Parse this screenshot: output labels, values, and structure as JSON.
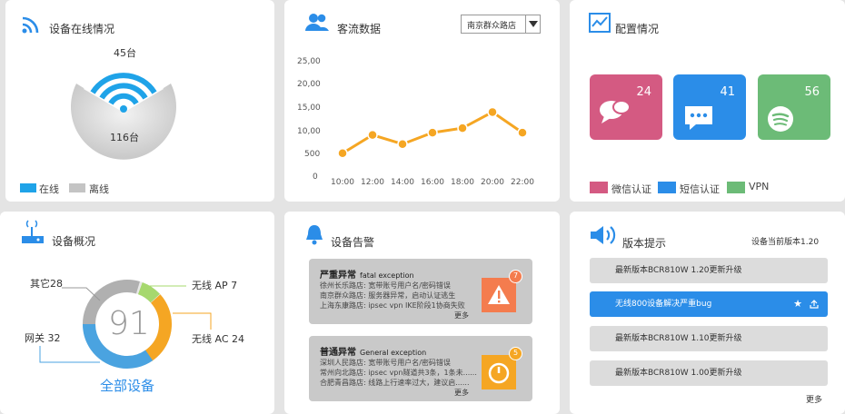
{
  "online": {
    "title": "设备在线情况",
    "online_count": "45台",
    "offline_count": "116台",
    "legend": [
      {
        "label": "在线",
        "color": "#1fa3e8"
      },
      {
        "label": "离线",
        "color": "#c4c4c4"
      }
    ]
  },
  "traffic": {
    "title": "客流数据",
    "store_select": "南京群众路店",
    "y_ticks": [
      "25,00",
      "20,00",
      "15,00",
      "10,00",
      "500",
      "0"
    ],
    "color": "#f5a623"
  },
  "config": {
    "title": "配置情况",
    "tiles": [
      {
        "count": "24",
        "label": "微信认证",
        "color": "#d45a82",
        "icon": "chat-bubbles-icon"
      },
      {
        "count": "41",
        "label": "短信认证",
        "color": "#2b8de8",
        "icon": "sms-icon"
      },
      {
        "count": "56",
        "label": "VPN",
        "color": "#6cbb77",
        "icon": "spotify-icon"
      }
    ]
  },
  "overview": {
    "title": "设备概况",
    "total": "91",
    "total_label": "全部设备",
    "labels": {
      "other": "其它28",
      "wireless_ap": "无线 AP  7",
      "wireless_ac": "无线 AC 24",
      "gateway": "网关 32"
    }
  },
  "alerts": {
    "title": "设备告警",
    "severe": {
      "title": "严重异常",
      "subtitle": "fatal exception",
      "lines": [
        "徐州长乐路店:   宽带账号用户名/密码错误",
        "南京群众路店:   服务器异常，启动认证逃生",
        "上海东康路店:   ipsec vpn IKE阶段1协商失败"
      ],
      "badge": "7",
      "more": "更多"
    },
    "general": {
      "title": "普通异常",
      "subtitle": "General exception",
      "lines": [
        "深圳人民路店:   宽带账号用户名/密码错误",
        "常州向北路店:   ipsec vpn隧道共3条，1条未......",
        "合肥青昌路店:   线路上行速率过大，建议启......"
      ],
      "badge": "5",
      "more": "更多"
    }
  },
  "versions": {
    "title": "版本提示",
    "current": "设备当前版本1.20",
    "items": [
      "最新版本BCR810W 1.20更新升级",
      "无线800设备解决严重bug",
      "最新版本BCR810W 1.10更新升级",
      "最新版本BCR810W 1.00更新升级"
    ],
    "more": "更多"
  },
  "chart_data": {
    "type": "line",
    "categories": [
      "10:00",
      "12:00",
      "14:00",
      "16:00",
      "18:00",
      "20:00",
      "22:00"
    ],
    "values": [
      500,
      900,
      700,
      950,
      1050,
      1400,
      950
    ],
    "ylim": [
      0,
      2500
    ],
    "y_tick_labels": [
      "0",
      "500",
      "10,00",
      "15,00",
      "20,00",
      "25,00"
    ],
    "grid": false
  }
}
